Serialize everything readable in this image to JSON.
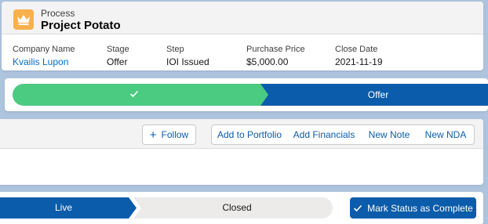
{
  "header": {
    "object_label": "Process",
    "title": "Project Potato",
    "icon": "crown-icon",
    "icon_color": "#f8b04d",
    "fields": [
      {
        "label": "Company Name",
        "value": "Kvailis Lupon"
      },
      {
        "label": "Stage",
        "value": "Offer"
      },
      {
        "label": "Step",
        "value": "IOI Issued"
      },
      {
        "label": "Purchase Price",
        "value": "$5,000.00"
      },
      {
        "label": "Close Date",
        "value": "2021-11-19"
      }
    ]
  },
  "path": {
    "completed_icon": "check-icon",
    "current_label": "Offer",
    "complete_color": "#4bca81",
    "current_color": "#0b5cab"
  },
  "actions": {
    "follow_label": "Follow",
    "buttons": [
      "Add to Portfolio",
      "Add Financials",
      "New Note",
      "New NDA"
    ]
  },
  "status": {
    "steps": [
      "Live",
      "Closed"
    ],
    "mark_complete_label": "Mark Status as Complete",
    "accent_color": "#0b5cab"
  }
}
